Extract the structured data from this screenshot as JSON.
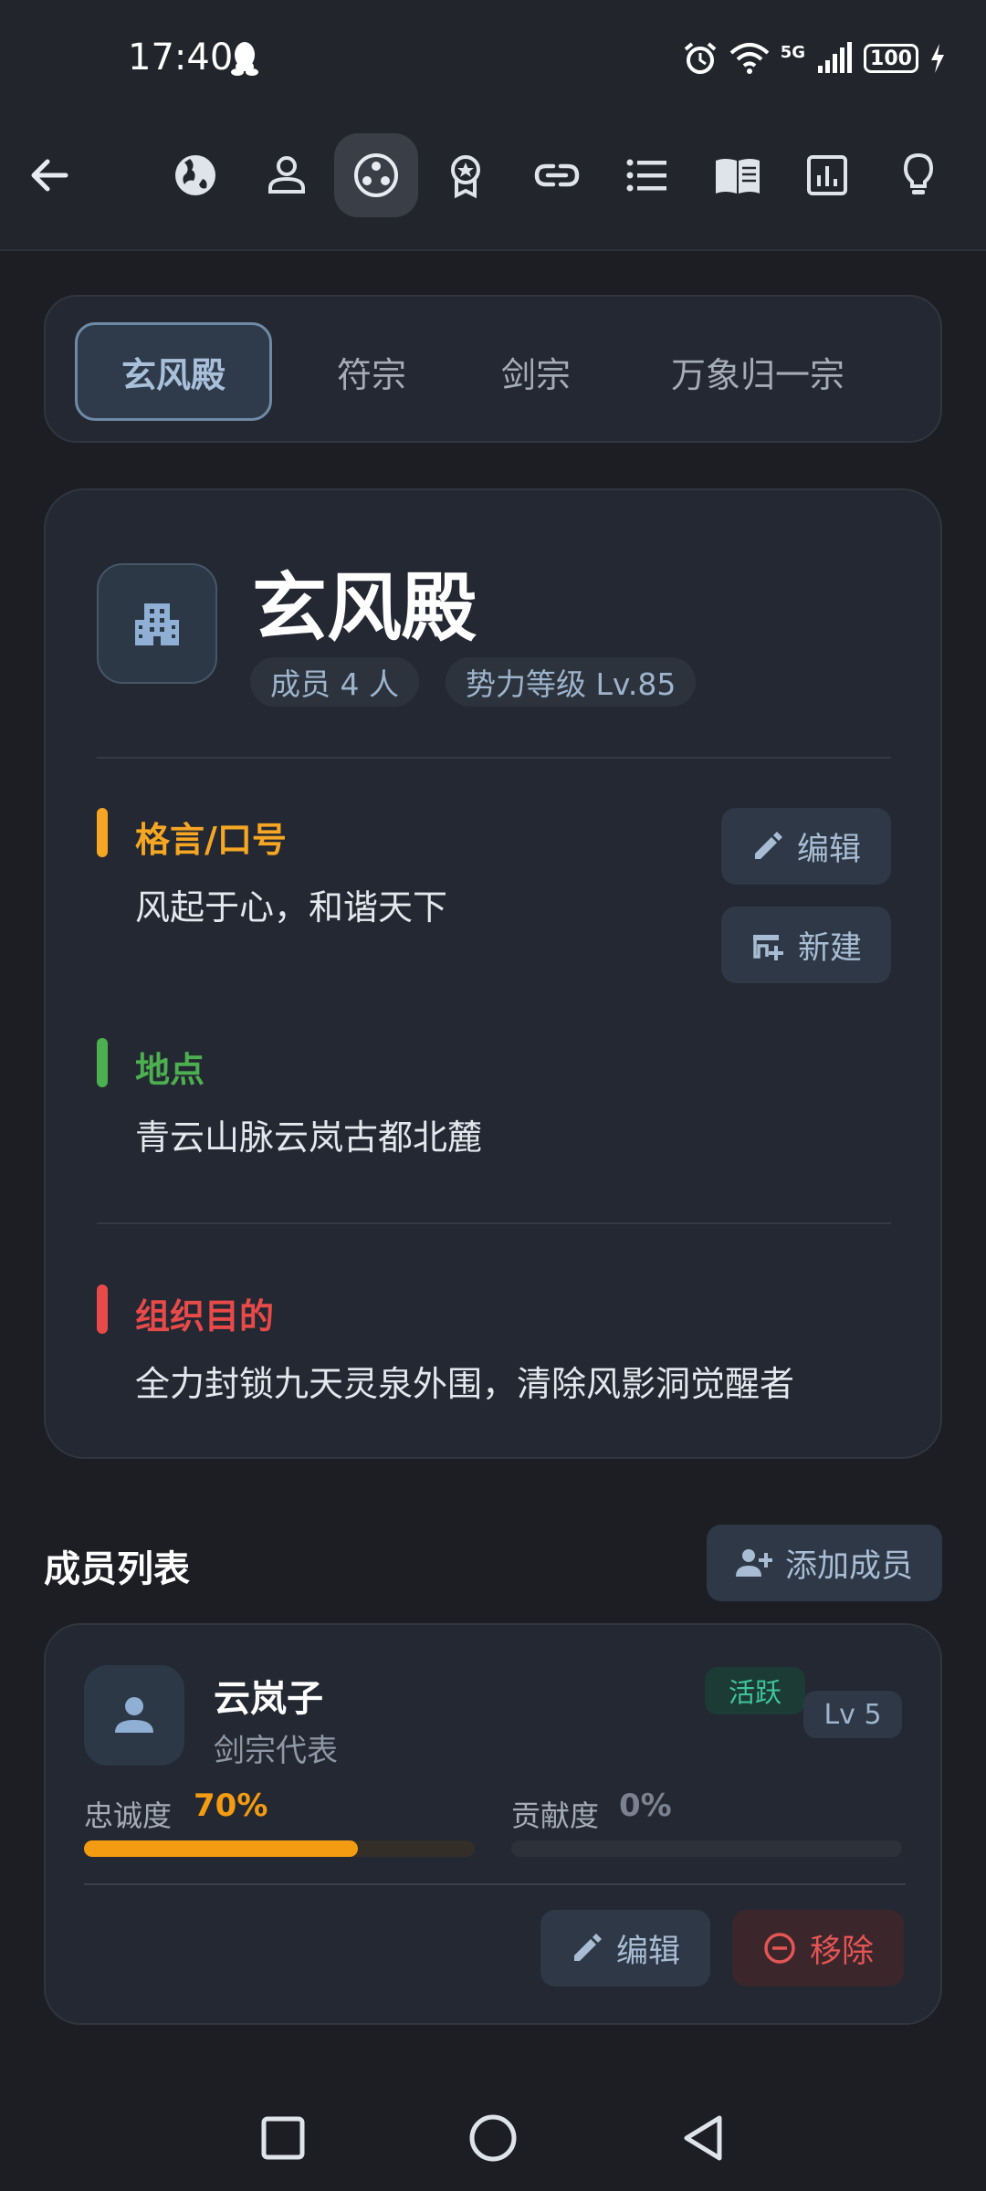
{
  "status_bar": {
    "time": "17:40",
    "battery": "100",
    "network": "5G"
  },
  "toolbar": {
    "icons": [
      "back-arrow-icon",
      "globe-icon",
      "person-icon",
      "group-circle-icon",
      "award-icon",
      "link-icon",
      "list-icon",
      "book-icon",
      "chart-icon",
      "lightbulb-icon"
    ],
    "active_index": 3
  },
  "tabs": [
    {
      "label": "玄风殿",
      "active": true
    },
    {
      "label": "符宗",
      "active": false
    },
    {
      "label": "剑宗",
      "active": false
    },
    {
      "label": "万象归一宗",
      "active": false
    }
  ],
  "faction": {
    "name": "玄风殿",
    "members_chip": "成员 4 人",
    "level_chip": "势力等级 Lv.85",
    "icon": "building-icon",
    "sections": [
      {
        "title": "格言/口号",
        "body": "风起于心，和谐天下",
        "color": "#f5a623"
      },
      {
        "title": "地点",
        "body": "青云山脉云岚古都北麓",
        "color": "#4caf50"
      },
      {
        "title": "组织目的",
        "body": "全力封锁九天灵泉外围，清除风影洞觉醒者",
        "color": "#e84a4a"
      }
    ],
    "edit_label": "编辑",
    "new_label": "新建"
  },
  "member_list": {
    "title": "成员列表",
    "add_label": "添加成员",
    "members": [
      {
        "name": "云岚子",
        "role": "剑宗代表",
        "status": "活跃",
        "level": "Lv 5",
        "loyalty_label": "忠诚度",
        "loyalty_value": "70%",
        "loyalty_fraction": 0.7,
        "contribution_label": "贡献度",
        "contribution_value": "0%",
        "contribution_fraction": 0.0,
        "edit_label": "编辑",
        "remove_label": "移除"
      }
    ]
  },
  "colors": {
    "background": "#1c1e24",
    "card": "#242832",
    "accent_orange": "#f39c12",
    "accent_green": "#3fc59b",
    "accent_red": "#e45555"
  }
}
